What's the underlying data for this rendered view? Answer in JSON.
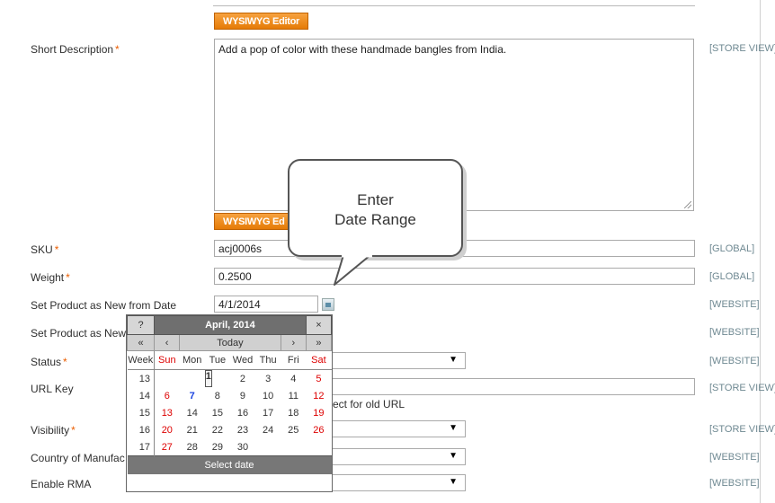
{
  "wysiwyg_label": "WYSIWYG Editor",
  "wysiwyg_label_partial": "WYSIWYG Ed",
  "short_description": {
    "label": "Short Description",
    "value": "Add a pop of color with these handmade bangles from India.",
    "scope": "[STORE VIEW]"
  },
  "sku": {
    "label": "SKU",
    "value": "acj0006s",
    "scope": "[GLOBAL]"
  },
  "weight": {
    "label": "Weight",
    "value": "0.2500",
    "scope": "[GLOBAL]"
  },
  "new_from": {
    "label": "Set Product as New from Date",
    "value": "4/1/2014",
    "scope": "[WEBSITE]"
  },
  "new_to": {
    "label": "Set Product as New",
    "scope": "[WEBSITE]"
  },
  "status": {
    "label": "Status",
    "scope": "[WEBSITE]"
  },
  "url_key": {
    "label": "URL Key",
    "scope": "[STORE VIEW]",
    "redirect_text": "ect for old URL"
  },
  "visibility": {
    "label": "Visibility",
    "scope": "[STORE VIEW]"
  },
  "country": {
    "label": "Country of Manufac",
    "scope": "[WEBSITE]"
  },
  "rma": {
    "label": "Enable RMA",
    "scope": "[WEBSITE]"
  },
  "bubble": {
    "line1": "Enter",
    "line2": "Date Range"
  },
  "calendar": {
    "help": "?",
    "title": "April, 2014",
    "close": "×",
    "prev_year": "«",
    "prev_month": "‹",
    "today": "Today",
    "next_month": "›",
    "next_year": "»",
    "week_header": "Week",
    "day_names": [
      "Sun",
      "Mon",
      "Tue",
      "Wed",
      "Thu",
      "Fri",
      "Sat"
    ],
    "weeks": [
      {
        "week": "13",
        "days": [
          "",
          "",
          "1",
          "2",
          "3",
          "4",
          "5"
        ]
      },
      {
        "week": "14",
        "days": [
          "6",
          "7",
          "8",
          "9",
          "10",
          "11",
          "12"
        ]
      },
      {
        "week": "15",
        "days": [
          "13",
          "14",
          "15",
          "16",
          "17",
          "18",
          "19"
        ]
      },
      {
        "week": "16",
        "days": [
          "20",
          "21",
          "22",
          "23",
          "24",
          "25",
          "26"
        ]
      },
      {
        "week": "17",
        "days": [
          "27",
          "28",
          "29",
          "30",
          "",
          "",
          ""
        ]
      }
    ],
    "selected_day": "1",
    "today_day": "7",
    "footer": "Select date"
  },
  "colors": {
    "accent": "#eb5e00",
    "scope": "#6f8992"
  },
  "icons": [
    "calendar-icon",
    "dropdown-arrow-icon",
    "resize-grip-icon"
  ]
}
